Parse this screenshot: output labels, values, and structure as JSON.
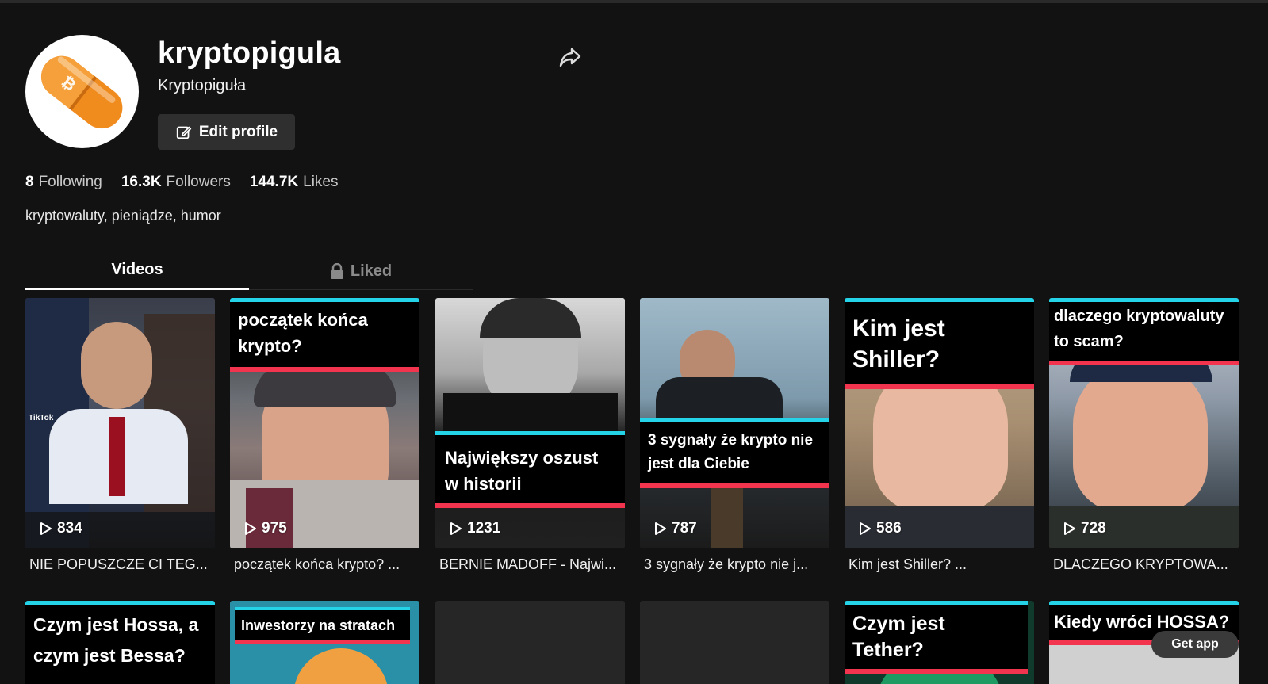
{
  "profile": {
    "username": "kryptopigula",
    "nickname": "Kryptopiguła",
    "edit_label": "Edit profile",
    "bio": "kryptowaluty, pieniądze, humor",
    "avatar_icon": "bitcoin-pill-icon",
    "stats": {
      "following_count": "8",
      "following_label": "Following",
      "followers_count": "16.3K",
      "followers_label": "Followers",
      "likes_count": "144.7K",
      "likes_label": "Likes"
    }
  },
  "tabs": {
    "videos": "Videos",
    "liked": "Liked"
  },
  "videos": [
    {
      "views": "834",
      "caption": "NIE POPUSZCZE CI TEG...",
      "overlay": ""
    },
    {
      "views": "975",
      "caption": "początek końca krypto? ...",
      "overlay": "początek końca krypto?"
    },
    {
      "views": "1231",
      "caption": "BERNIE MADOFF - Najwi...",
      "overlay": "Największy oszust w historii"
    },
    {
      "views": "787",
      "caption": "3 sygnały że krypto nie j...",
      "overlay": "3 sygnały że krypto nie jest dla Ciebie"
    },
    {
      "views": "586",
      "caption": "Kim jest Shiller? ...",
      "overlay": "Kim jest Shiller?"
    },
    {
      "views": "728",
      "caption": "DLACZEGO KRYPTOWA...",
      "overlay": "dlaczego kryptowaluty to scam?"
    }
  ],
  "videos_row2": [
    {
      "overlay": "Czym jest Hossa, a czym jest Bessa?"
    },
    {
      "overlay": "Inwestorzy na stratach"
    },
    {
      "overlay": ""
    },
    {
      "overlay": ""
    },
    {
      "overlay": "Czym jest Tether?"
    },
    {
      "overlay": "Kiedy wróci HOSSA?"
    }
  ],
  "tiktok_watermark": "TikTok",
  "get_app": "Get app"
}
